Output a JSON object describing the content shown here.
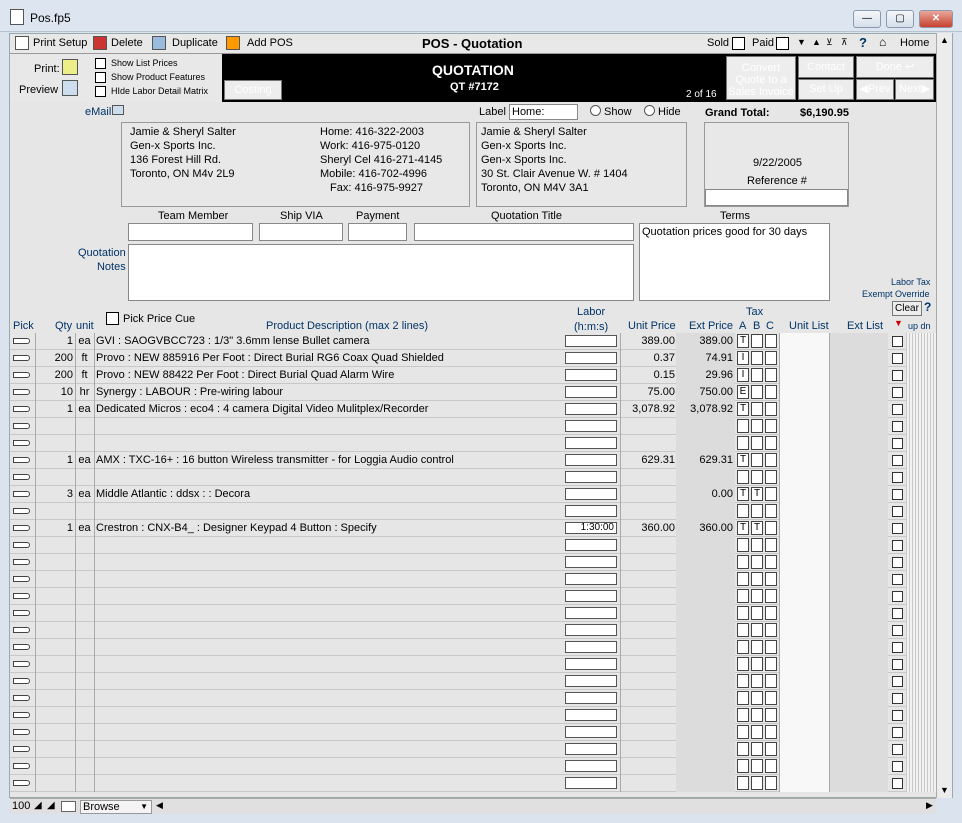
{
  "window": {
    "title": "Pos.fp5",
    "min": "—",
    "max": "▢",
    "close": "✕"
  },
  "toolbar": {
    "print_setup": "Print Setup",
    "delete": "Delete",
    "duplicate": "Duplicate",
    "add_pos": "Add POS",
    "title": "POS - Quotation",
    "sold": "Sold",
    "paid": "Paid",
    "help": "?",
    "home": "Home"
  },
  "header": {
    "print": "Print:",
    "preview": "Preview",
    "show_list_prices": "Show List Prices",
    "show_product_features": "Show Product Features",
    "hide_labor": "HIde Labor Detail Matrix",
    "costing": "Costing",
    "quotation": "QUOTATION",
    "qt_number": "QT #7172",
    "record_pos": "2 of 16",
    "convert": "Convert Quote to a Sales Invoice",
    "contact": "Contact",
    "setup": "Set Up",
    "done": "Done",
    "prev": "Prev",
    "next": "Next"
  },
  "customer": {
    "email_label": "eMail",
    "name": "Jamie & Sheryl Salter",
    "company": "Gen-x Sports Inc.",
    "address": "136 Forest Hill Rd.",
    "city": "Toronto, ON M4v 2L9",
    "home": "Home: 416-322-2003",
    "work": "Work: 416-975-0120",
    "cell": "Sheryl Cel 416-271-4145",
    "mobile": "Mobile: 416-702-4996",
    "fax": "Fax: 416-975-9927"
  },
  "label": {
    "label": "Label",
    "value": "Home:",
    "show": "Show",
    "hide": "Hide",
    "name": "Jamie & Sheryl Salter",
    "l2": "Gen-x Sports Inc.",
    "l3": "Gen-x Sports Inc.",
    "l4": "30 St. Clair Avenue W. # 1404",
    "l5": "Toronto, ON M4V 3A1"
  },
  "totals": {
    "grand_total_label": "Grand Total:",
    "grand_total": "$6,190.95",
    "date": "9/22/2005",
    "reference": "Reference #"
  },
  "fields": {
    "team_member": "Team Member",
    "ship_via": "Ship VIA",
    "payment": "Payment",
    "quotation_title": "Quotation Title",
    "terms": "Terms",
    "terms_value": "Quotation prices good for 30 days",
    "notes": "Quotation\nNotes",
    "labor_tax": "Labor Tax",
    "exempt": "Exempt Override",
    "clear": "Clear",
    "pick_price_cue": "Pick Price Cue"
  },
  "columns": {
    "pick": "Pick",
    "qty": "Qty",
    "unit": "unit",
    "desc": "Product Description (max 2 lines)",
    "labor": "Labor",
    "labor2": "(h:m:s)",
    "unit_price": "Unit Price",
    "ext_price": "Ext Price",
    "tax": "Tax",
    "a": "A",
    "b": "B",
    "c": "C",
    "unit_list": "Unit List",
    "ext_list": "Ext List",
    "updn": "up dn"
  },
  "lines": [
    {
      "qty": "1",
      "unit": "ea",
      "desc": "GVI : SAOGVBCC723 : 1/3\" 3.6mm lense  Bullet camera",
      "labor": "",
      "unit_price": "389.00",
      "ext_price": "389.00",
      "tax_a": "T",
      "tax_b": "",
      "tax_c": ""
    },
    {
      "qty": "200",
      "unit": "ft",
      "desc": "Provo : NEW 885916 Per Foot : Direct Burial RG6 Coax Quad Shielded",
      "labor": "",
      "unit_price": "0.37",
      "ext_price": "74.91",
      "tax_a": "I",
      "tax_b": "",
      "tax_c": ""
    },
    {
      "qty": "200",
      "unit": "ft",
      "desc": "Provo : NEW 88422 Per Foot : Direct Burial Quad Alarm Wire",
      "labor": "",
      "unit_price": "0.15",
      "ext_price": "29.96",
      "tax_a": "I",
      "tax_b": "",
      "tax_c": ""
    },
    {
      "qty": "10",
      "unit": "hr",
      "desc": "Synergy : LABOUR : Pre-wiring labour",
      "labor": "",
      "unit_price": "75.00",
      "ext_price": "750.00",
      "tax_a": "E",
      "tax_b": "",
      "tax_c": ""
    },
    {
      "qty": "1",
      "unit": "ea",
      "desc": "Dedicated Micros : eco4 : 4 camera Digital Video Mulitplex/Recorder",
      "labor": "",
      "unit_price": "3,078.92",
      "ext_price": "3,078.92",
      "tax_a": "T",
      "tax_b": "",
      "tax_c": ""
    },
    {
      "qty": "",
      "unit": "",
      "desc": "",
      "labor": "",
      "unit_price": "",
      "ext_price": "",
      "tax_a": "",
      "tax_b": "",
      "tax_c": ""
    },
    {
      "qty": "",
      "unit": "",
      "desc": "",
      "labor": "",
      "unit_price": "",
      "ext_price": "",
      "tax_a": "",
      "tax_b": "",
      "tax_c": ""
    },
    {
      "qty": "1",
      "unit": "ea",
      "desc": "AMX : TXC-16+ : 16 button Wireless transmitter - for Loggia Audio control",
      "labor": "",
      "unit_price": "629.31",
      "ext_price": "629.31",
      "tax_a": "T",
      "tax_b": "",
      "tax_c": ""
    },
    {
      "qty": "",
      "unit": "",
      "desc": "",
      "labor": "",
      "unit_price": "",
      "ext_price": "",
      "tax_a": "",
      "tax_b": "",
      "tax_c": ""
    },
    {
      "qty": "3",
      "unit": "ea",
      "desc": "Middle Atlantic : ddsx :  : Decora",
      "labor": "",
      "unit_price": "",
      "ext_price": "0.00",
      "tax_a": "T",
      "tax_b": "T",
      "tax_c": ""
    },
    {
      "qty": "",
      "unit": "",
      "desc": "",
      "labor": "",
      "unit_price": "",
      "ext_price": "",
      "tax_a": "",
      "tax_b": "",
      "tax_c": ""
    },
    {
      "qty": "1",
      "unit": "ea",
      "desc": "Crestron : CNX-B4_ : Designer Keypad 4 Button : Specify",
      "labor": "1:30:00",
      "unit_price": "360.00",
      "ext_price": "360.00",
      "tax_a": "T",
      "tax_b": "T",
      "tax_c": ""
    }
  ],
  "status": {
    "zoom": "100",
    "mode": "Browse"
  }
}
